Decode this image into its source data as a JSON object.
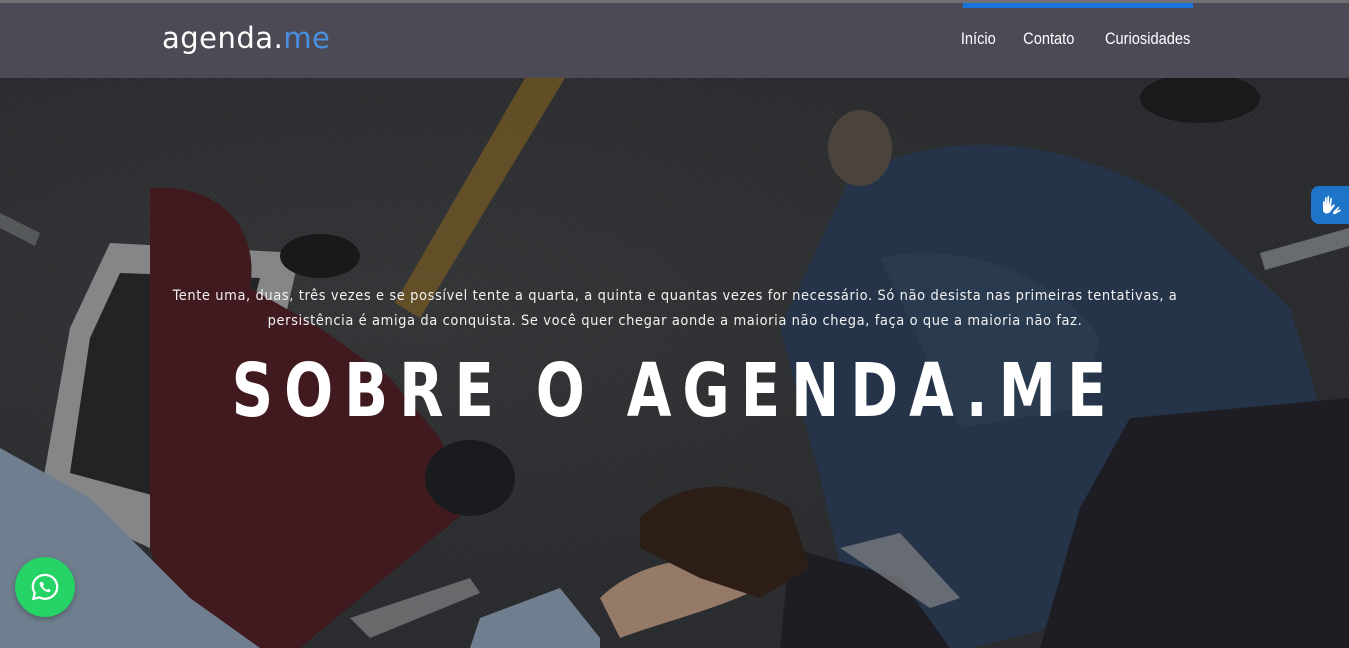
{
  "brand": {
    "name_main": "agenda.",
    "name_accent": "me"
  },
  "nav": {
    "items": [
      {
        "label": "Início"
      },
      {
        "label": "Contato"
      },
      {
        "label": "Curiosidades"
      }
    ]
  },
  "hero": {
    "quote_line1": "Tente uma, duas, três vezes e se possível tente a quarta, a quinta e quantas vezes for necessário. Só não desista nas primeiras tentativas, a",
    "quote_line2": "persistência é amiga da conquista. Se você quer chegar aonde a maioria não chega, faça o que a maioria não faz.",
    "title": "SOBRE O AGENDA.ME"
  },
  "floating": {
    "whatsapp_icon": "whatsapp-icon",
    "accessibility_icon": "sign-language-icon"
  },
  "colors": {
    "navbar": "#4b4a55",
    "accent": "#1a73d9",
    "brand_accent": "#4a90e2",
    "whatsapp": "#25d366"
  }
}
